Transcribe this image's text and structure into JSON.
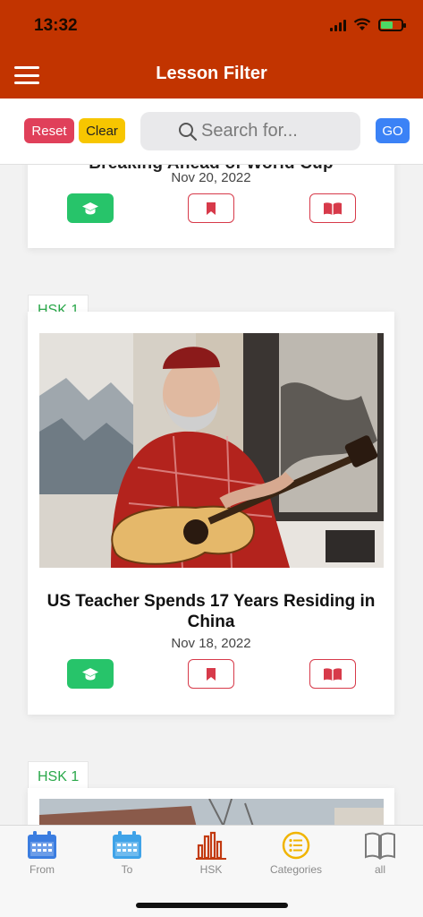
{
  "status_bar": {
    "time": "13:32"
  },
  "header": {
    "title": "Lesson Filter"
  },
  "filter": {
    "reset_label": "Reset",
    "clear_label": "Clear",
    "search_placeholder": "Search for...",
    "go_label": "GO"
  },
  "lessons": [
    {
      "title": "Breaking Ahead of World Cup",
      "date": "Nov 20, 2022"
    },
    {
      "tag": "HSK 1",
      "title": "US Teacher Spends 17 Years Residing in China",
      "date": "Nov 18, 2022"
    },
    {
      "tag": "HSK 1"
    }
  ],
  "tabs": [
    {
      "label": "From",
      "icon": "calendar-icon"
    },
    {
      "label": "To",
      "icon": "calendar-icon"
    },
    {
      "label": "HSK",
      "icon": "bar-chart-icon"
    },
    {
      "label": "Categories",
      "icon": "list-icon"
    },
    {
      "label": "all",
      "icon": "book-open-icon"
    }
  ],
  "colors": {
    "header": "#c23400",
    "reset": "#e0405a",
    "clear": "#f7c600",
    "go": "#3b82f6",
    "learn": "#27c46a",
    "action_outline": "#d73a4a",
    "tag_text": "#2aa84a",
    "tab_from": "#3b7de0",
    "tab_to": "#3fa3e8",
    "tab_hsk": "#c23a10",
    "tab_categories": "#f0b400"
  }
}
